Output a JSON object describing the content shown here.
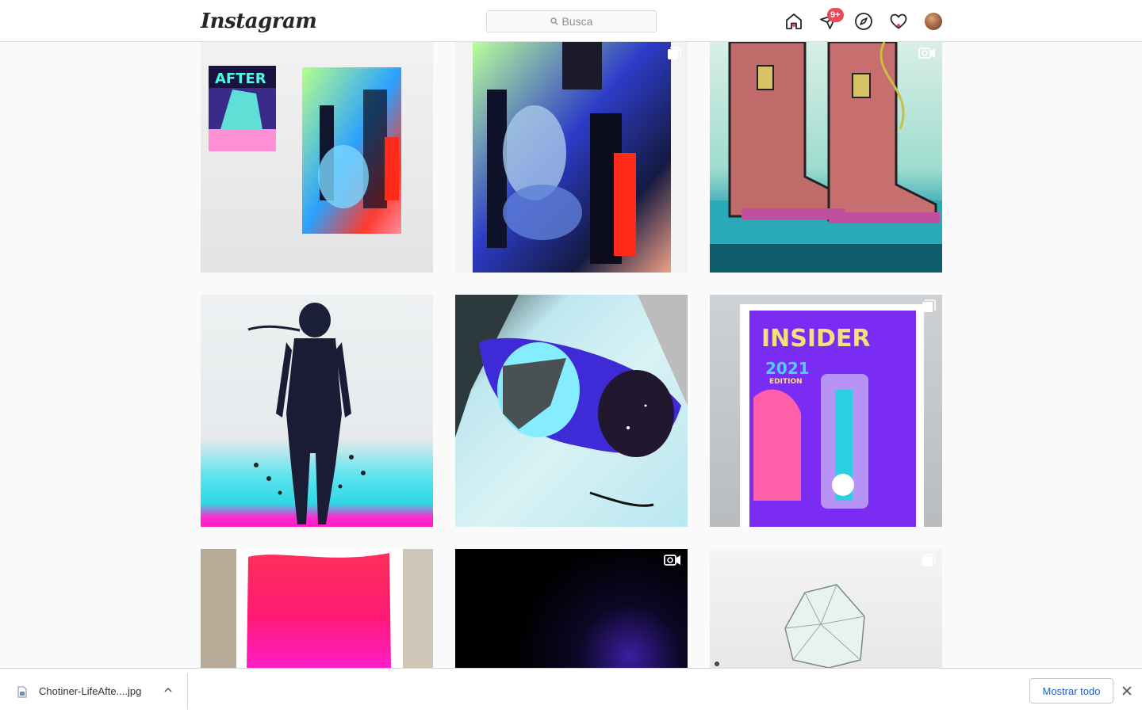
{
  "header": {
    "logo": "Instagram",
    "search_placeholder": "Busca",
    "notifications_badge": "9+"
  },
  "posts": [
    {
      "alt": "After comic cover and painting on wall",
      "type": "image"
    },
    {
      "alt": "Painting of figure seated",
      "type": "carousel"
    },
    {
      "alt": "Illustrated boots",
      "type": "video"
    },
    {
      "alt": "Figure in helmet walking",
      "type": "image"
    },
    {
      "alt": "Face with broken goggles",
      "type": "image"
    },
    {
      "alt": "Insider 2021 Edition action figure",
      "type": "carousel"
    },
    {
      "alt": "Pink gradient painting",
      "type": "image"
    },
    {
      "alt": "Dark video",
      "type": "video"
    },
    {
      "alt": "Crystal drawing",
      "type": "carousel"
    }
  ],
  "download_bar": {
    "filename": "Chotiner-LifeAfte....jpg",
    "show_all_label": "Mostrar todo"
  },
  "colors": {
    "notification_red": "#ed4956",
    "link_blue": "#1a5fc9"
  }
}
